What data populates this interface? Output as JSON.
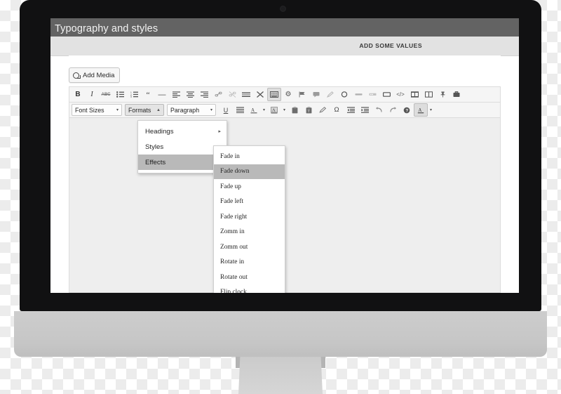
{
  "device": {
    "type": "desktop-monitor",
    "bezel_color": "#111112",
    "chin_color": "#c9c9c9"
  },
  "page": {
    "title": "Typography and styles",
    "header_bg": "#636363",
    "subbar": {
      "label": "ADD SOME VALUES",
      "bg": "#e2e2e2"
    }
  },
  "editor": {
    "add_media_label": "Add Media",
    "add_media_icon": "media-camera-icon",
    "toolbar_row1": [
      {
        "name": "bold",
        "glyph": "B"
      },
      {
        "name": "italic",
        "glyph": "I"
      },
      {
        "name": "strikethrough",
        "glyph": "ABC"
      },
      {
        "name": "bulleted-list",
        "glyph": "list-ul"
      },
      {
        "name": "numbered-list",
        "glyph": "list-ol"
      },
      {
        "name": "blockquote",
        "glyph": "“"
      },
      {
        "name": "horizontal-rule",
        "glyph": "—"
      },
      {
        "name": "align-left",
        "glyph": "align-left"
      },
      {
        "name": "align-center",
        "glyph": "align-center"
      },
      {
        "name": "align-right",
        "glyph": "align-right"
      },
      {
        "name": "insert-link",
        "glyph": "link"
      },
      {
        "name": "unlink",
        "glyph": "unlink"
      },
      {
        "name": "read-more",
        "glyph": "more"
      },
      {
        "name": "distraction-free",
        "glyph": "✕"
      },
      {
        "name": "toggle-toolbar",
        "glyph": "kitchen-sink",
        "active": true
      },
      {
        "name": "settings-gear",
        "glyph": "⚙"
      },
      {
        "name": "flag",
        "glyph": "flag"
      },
      {
        "name": "comment",
        "glyph": "comment"
      },
      {
        "name": "pencil",
        "glyph": "pencil"
      },
      {
        "name": "circle",
        "glyph": "○"
      },
      {
        "name": "minus-bar",
        "glyph": "bar"
      },
      {
        "name": "quote-box",
        "glyph": "quote"
      },
      {
        "name": "rectangle",
        "glyph": "▭"
      },
      {
        "name": "source-code",
        "glyph": "</>"
      },
      {
        "name": "gallery",
        "glyph": "grid"
      },
      {
        "name": "columns",
        "glyph": "columns"
      },
      {
        "name": "pin",
        "glyph": "pin"
      },
      {
        "name": "briefcase",
        "glyph": "briefcase"
      }
    ],
    "toolbar_row2": {
      "font_sizes": "Font Sizes",
      "formats": "Formats",
      "formats_caret": "▲",
      "paragraph": "Paragraph",
      "caret": "▾",
      "buttons": [
        {
          "name": "underline",
          "glyph": "U"
        },
        {
          "name": "justify",
          "glyph": "justify"
        },
        {
          "name": "text-color",
          "glyph": "A"
        },
        {
          "name": "background-color",
          "glyph": "A",
          "boxed": true
        },
        {
          "name": "paste",
          "glyph": "clipboard"
        },
        {
          "name": "paste-as-text",
          "glyph": "clipboard-t"
        },
        {
          "name": "clear-formatting",
          "glyph": "eraser"
        },
        {
          "name": "special-character",
          "glyph": "Ω"
        },
        {
          "name": "outdent",
          "glyph": "outdent"
        },
        {
          "name": "indent",
          "glyph": "indent"
        },
        {
          "name": "undo",
          "glyph": "↶"
        },
        {
          "name": "redo",
          "glyph": "↷"
        },
        {
          "name": "keyboard-shortcuts",
          "glyph": "?"
        },
        {
          "name": "anchor-color",
          "glyph": "A",
          "active": true
        }
      ]
    }
  },
  "formats_menu": {
    "items": [
      {
        "label": "Headings",
        "has_submenu": true,
        "highlighted": false
      },
      {
        "label": "Styles",
        "has_submenu": true,
        "highlighted": false
      },
      {
        "label": "Effects",
        "has_submenu": true,
        "highlighted": true
      }
    ],
    "submenu_arrow": "▸"
  },
  "effects_menu": {
    "items": [
      {
        "label": "Fade in",
        "highlighted": false
      },
      {
        "label": "Fade down",
        "highlighted": true
      },
      {
        "label": "Fade up",
        "highlighted": false
      },
      {
        "label": "Fade left",
        "highlighted": false
      },
      {
        "label": "Fade right",
        "highlighted": false
      },
      {
        "label": "Zomm in",
        "highlighted": false
      },
      {
        "label": "Zomm out",
        "highlighted": false
      },
      {
        "label": "Rotate in",
        "highlighted": false
      },
      {
        "label": "Rotate out",
        "highlighted": false
      },
      {
        "label": "Flip clock",
        "highlighted": false
      }
    ]
  }
}
